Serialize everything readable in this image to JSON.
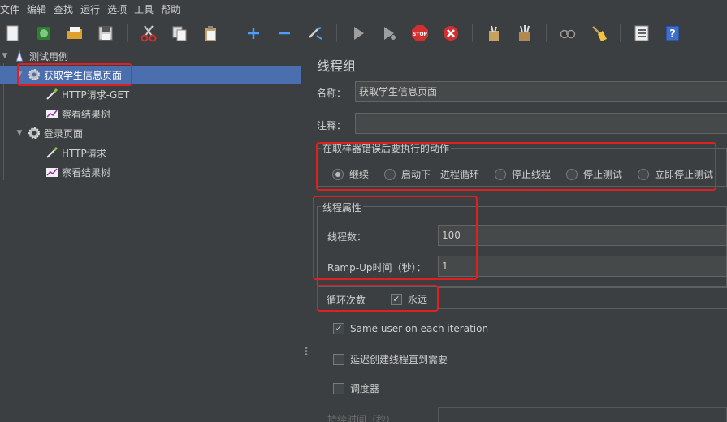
{
  "menu": [
    "文件",
    "编辑",
    "查找",
    "运行",
    "选项",
    "工具",
    "帮助"
  ],
  "toolbar": {
    "icons": [
      "new-icon",
      "templates-icon",
      "open-icon",
      "save-icon",
      "cut-icon",
      "copy-icon",
      "paste-icon",
      "add-icon",
      "remove-icon",
      "toggle-icon",
      "start-icon",
      "start-no-pause-icon",
      "stop-icon",
      "shutdown-icon",
      "clear-icon",
      "clear-all-icon",
      "search-icon",
      "reset-search-icon",
      "function-helper-icon",
      "help-icon"
    ]
  },
  "tree": {
    "items": [
      {
        "label": "测试用例",
        "icon": "test-plan-icon"
      },
      {
        "label": "获取学生信息页面",
        "icon": "thread-group-gear-icon"
      },
      {
        "label": "HTTP请求-GET",
        "icon": "sampler-pipette-icon"
      },
      {
        "label": "察看结果树",
        "icon": "listener-chart-icon"
      },
      {
        "label": "登录页面",
        "icon": "thread-group-gear-icon"
      },
      {
        "label": "HTTP请求",
        "icon": "sampler-pipette-icon"
      },
      {
        "label": "察看结果树",
        "icon": "listener-chart-icon"
      }
    ]
  },
  "panel": {
    "title": "线程组",
    "name_label": "名称：",
    "name_value": "获取学生信息页面",
    "comment_label": "注释：",
    "comment_value": "",
    "error_group_title": "在取样器错误后要执行的动作",
    "error_options": [
      "继续",
      "启动下一进程循环",
      "停止线程",
      "停止测试",
      "立即停止测试"
    ],
    "error_selected": "继续",
    "thread_group_title": "线程属性",
    "threads_label": "线程数：",
    "threads_value": "100",
    "rampup_label": "Ramp-Up时间（秒）：",
    "rampup_value": "1",
    "loop_label": "循环次数",
    "forever_label": "永远",
    "forever_checked": true,
    "same_user_label": "Same user on each iteration",
    "same_user_checked": true,
    "delay_label": "延迟创建线程直到需要",
    "delay_checked": false,
    "scheduler_label": "调度器",
    "scheduler_checked": false,
    "duration_label": "持续时间（秒）"
  },
  "colors": {
    "background": "#3c3f41",
    "selection": "#4b6eaf",
    "highlight_box": "#e02020",
    "stop_red": "#d32f2f"
  }
}
